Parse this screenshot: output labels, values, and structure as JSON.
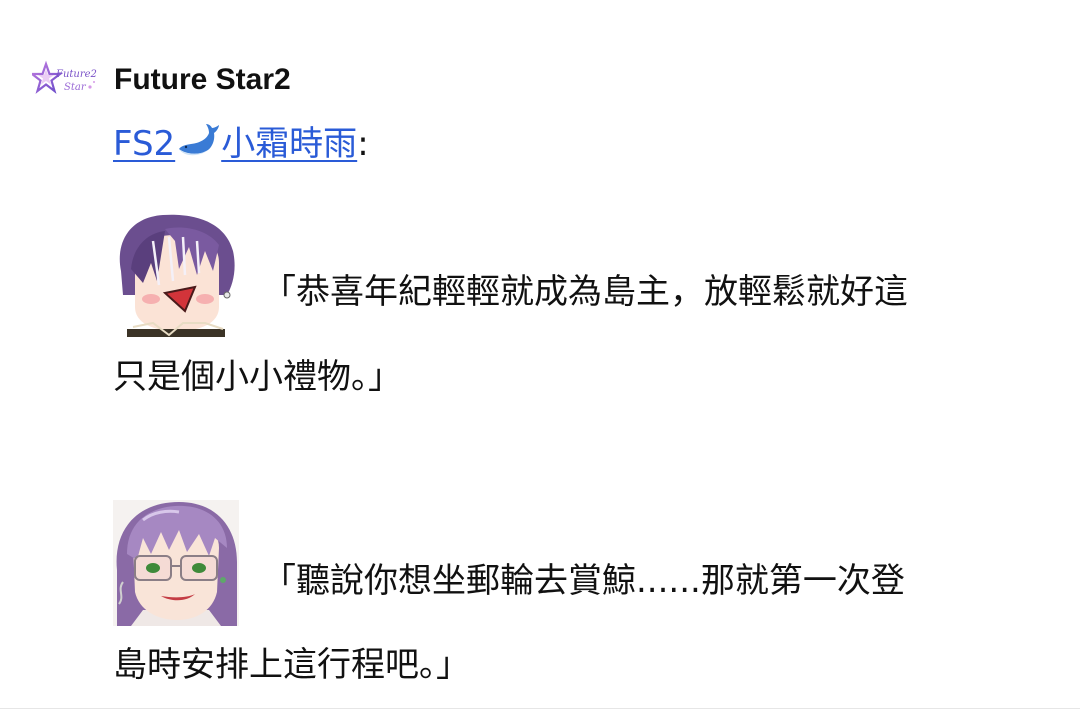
{
  "channel": {
    "name": "Future Star2",
    "logo_text_line1": "Future2",
    "logo_text_line2": "Star",
    "logo_icon": "star-logo-icon"
  },
  "post": {
    "author_prefix": "FS2",
    "author_emoji": "whale-icon",
    "author_suffix": "小霜時雨",
    "author_separator": ":",
    "messages": [
      {
        "avatar": "purple-hair-chibi-avatar",
        "line1": "「恭喜年紀輕輕就成為島主，放輕鬆就好這",
        "line2": "只是個小小禮物。」"
      },
      {
        "avatar": "purple-hair-glasses-avatar",
        "line1": "「聽說你想坐郵輪去賞鯨......那就第一次登",
        "line2": "島時安排上這行程吧。」"
      }
    ]
  },
  "colors": {
    "link": "#2a5bd7",
    "text": "#111111",
    "background": "#ffffff"
  }
}
